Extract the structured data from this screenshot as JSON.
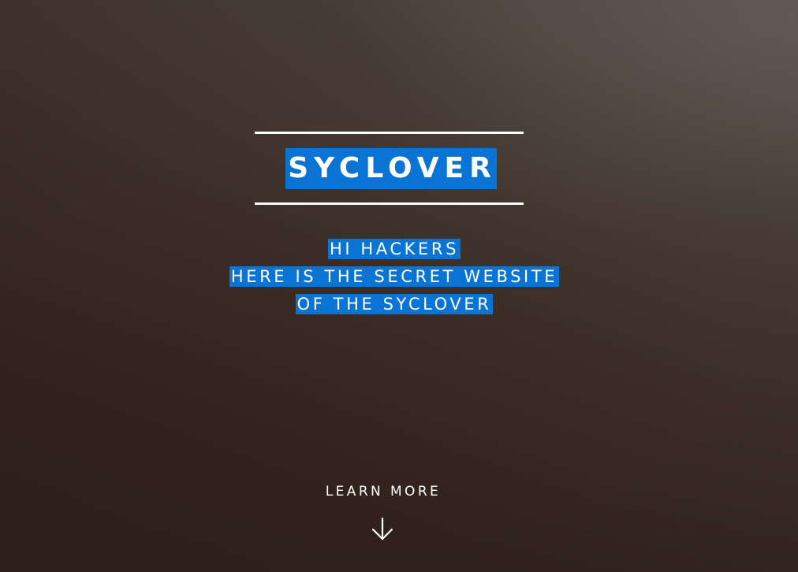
{
  "hero": {
    "title": "SYCLOVER",
    "subtitle_lines": [
      "HI HACKERS",
      "HERE IS THE SECRET WEBSITE",
      "OF THE SYCLOVER"
    ],
    "learn_more_label": "LEARN MORE"
  },
  "icons": {
    "scroll_arrow": "arrow-down-icon"
  },
  "colors": {
    "highlight": "#0a74d4",
    "text": "#ffffff",
    "background_dark": "#30221a"
  }
}
